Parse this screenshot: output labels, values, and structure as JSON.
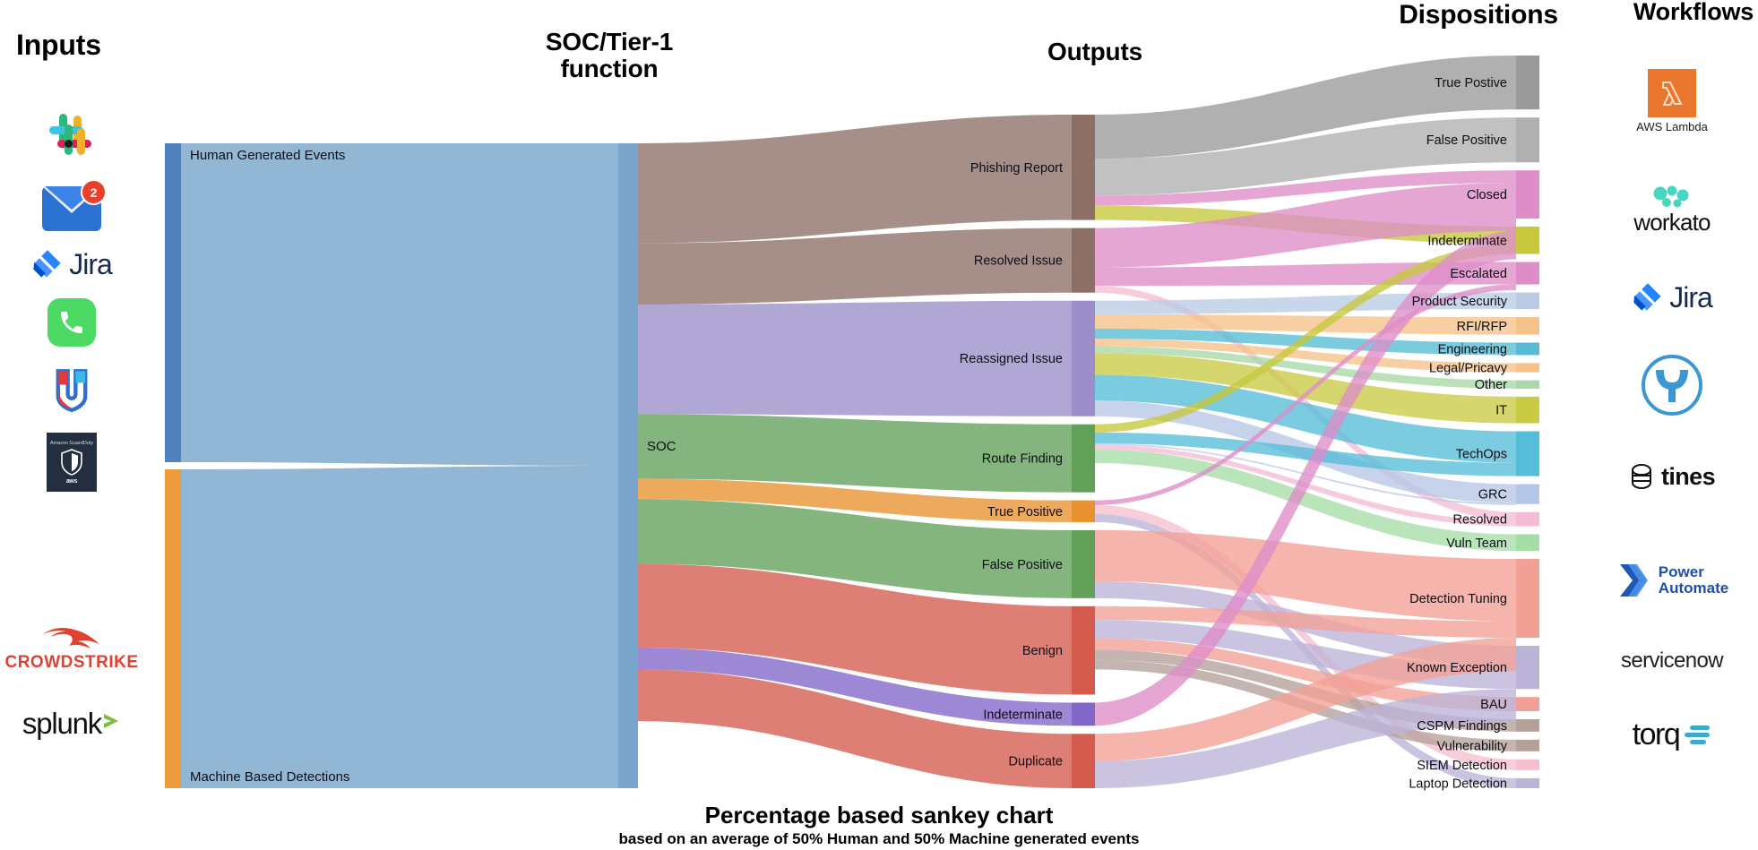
{
  "headers": {
    "inputs": "Inputs",
    "soc": "SOC/Tier-1\nfunction",
    "soc_line1": "SOC/Tier-1",
    "soc_line2": "function",
    "outputs": "Outputs",
    "dispositions": "Dispositions",
    "workflows": "Workflows"
  },
  "caption": {
    "title": "Percentage based sankey chart",
    "subtitle": "based on an average of 50% Human and 50% Machine generated events"
  },
  "input_logos": [
    {
      "name": "slack-logo",
      "label": ""
    },
    {
      "name": "email-logo",
      "label": "",
      "badge": "2"
    },
    {
      "name": "jira-logo",
      "label": "Jira"
    },
    {
      "name": "phone-logo",
      "label": ""
    },
    {
      "name": "jamf-logo",
      "label": ""
    },
    {
      "name": "amazon-guardduty-logo",
      "label": "Amazon GuardDuty",
      "sub": "aws"
    },
    {
      "name": "crowdstrike-logo",
      "label": "CROWDSTRIKE"
    },
    {
      "name": "splunk-logo",
      "label": "splunk"
    }
  ],
  "workflow_logos": [
    {
      "name": "aws-lambda-logo",
      "label": "AWS Lambda"
    },
    {
      "name": "workato-logo",
      "label": "workato"
    },
    {
      "name": "jira-logo",
      "label": "Jira"
    },
    {
      "name": "mulesoft-logo",
      "label": ""
    },
    {
      "name": "tines-logo",
      "label": "tines"
    },
    {
      "name": "power-automate-logo",
      "label": "Power Automate",
      "l1": "Power",
      "l2": "Automate"
    },
    {
      "name": "servicenow-logo",
      "label": "servicenow"
    },
    {
      "name": "torq-logo",
      "label": "torq"
    }
  ],
  "chart_data": {
    "type": "sankey",
    "title": "Percentage based sankey chart",
    "subtitle": "based on an average of 50% Human and 50% Machine generated events",
    "columns": [
      "Inputs",
      "SOC/Tier-1 function",
      "Outputs",
      "Dispositions"
    ],
    "units": "percent",
    "nodes": [
      {
        "id": "human",
        "label": "Human Generated Events",
        "column": 0,
        "value": 50,
        "color": "#4f81bd"
      },
      {
        "id": "machine",
        "label": "Machine Based Detections",
        "column": 0,
        "value": 50,
        "color": "#ed9c3c"
      },
      {
        "id": "soc",
        "label": "SOC",
        "column": 1,
        "value": 100,
        "color": "#7aa6cd"
      },
      {
        "id": "phishing",
        "label": "Phishing Report",
        "column": 2,
        "value": 15.5,
        "color": "#8c6f66"
      },
      {
        "id": "resolved_iss",
        "label": "Resolved Issue",
        "column": 2,
        "value": 9.5,
        "color": "#8c6f66"
      },
      {
        "id": "reassigned",
        "label": "Reassigned Issue",
        "column": 2,
        "value": 17.0,
        "color": "#9b8ec9"
      },
      {
        "id": "route",
        "label": "Route Finding",
        "column": 2,
        "value": 10.0,
        "color": "#62a05a"
      },
      {
        "id": "true_pos_o",
        "label": "True Positive",
        "column": 2,
        "value": 3.2,
        "color": "#e8922f"
      },
      {
        "id": "false_pos_o",
        "label": "False Positive",
        "column": 2,
        "value": 10.0,
        "color": "#62a05a"
      },
      {
        "id": "benign",
        "label": "Benign",
        "column": 2,
        "value": 13.0,
        "color": "#d45b4e"
      },
      {
        "id": "indet_o",
        "label": "Indeterminate",
        "column": 2,
        "value": 3.4,
        "color": "#8067c8"
      },
      {
        "id": "duplicate",
        "label": "Duplicate",
        "column": 2,
        "value": 8.0,
        "color": "#d45b4e"
      },
      {
        "id": "true_pos_d",
        "label": "True Postive",
        "column": 3,
        "value": 6.5,
        "color": "#9a9a9a"
      },
      {
        "id": "false_pos_d",
        "label": "False Positive",
        "column": 3,
        "value": 5.4,
        "color": "#b0b0b0"
      },
      {
        "id": "closed",
        "label": "Closed",
        "column": 3,
        "value": 5.8,
        "color": "#de8dc8"
      },
      {
        "id": "indet_d",
        "label": "Indeterminate",
        "column": 3,
        "value": 3.3,
        "color": "#c7c83c"
      },
      {
        "id": "escalated",
        "label": "Escalated",
        "column": 3,
        "value": 2.7,
        "color": "#de8dc8"
      },
      {
        "id": "prod_sec",
        "label": "Product Security",
        "column": 3,
        "value": 2.0,
        "color": "#bacce4"
      },
      {
        "id": "rfi_rfp",
        "label": "RFI/RFP",
        "column": 3,
        "value": 2.1,
        "color": "#f6c288"
      },
      {
        "id": "engineering",
        "label": "Engineering",
        "column": 3,
        "value": 1.5,
        "color": "#55bcd4"
      },
      {
        "id": "legal",
        "label": "Legal/Pricavy",
        "column": 3,
        "value": 1.1,
        "color": "#f6c288"
      },
      {
        "id": "other",
        "label": "Other",
        "column": 3,
        "value": 1.0,
        "color": "#a8d8a8"
      },
      {
        "id": "it",
        "label": "IT",
        "column": 3,
        "value": 3.2,
        "color": "#cacb45"
      },
      {
        "id": "techops",
        "label": "TechOps",
        "column": 3,
        "value": 5.4,
        "color": "#56bdd8"
      },
      {
        "id": "grc",
        "label": "GRC",
        "column": 3,
        "value": 2.4,
        "color": "#b6c6e6"
      },
      {
        "id": "resolved_d",
        "label": "Resolved",
        "column": 3,
        "value": 1.7,
        "color": "#f3bcd4"
      },
      {
        "id": "vuln_team",
        "label": "Vuln Team",
        "column": 3,
        "value": 2.0,
        "color": "#a6dda6"
      },
      {
        "id": "det_tuning",
        "label": "Detection Tuning",
        "column": 3,
        "value": 9.5,
        "color": "#f2a096"
      },
      {
        "id": "known_exc",
        "label": "Known Exception",
        "column": 3,
        "value": 5.2,
        "color": "#bcb4d8"
      },
      {
        "id": "bau",
        "label": "BAU",
        "column": 3,
        "value": 1.7,
        "color": "#f2a096"
      },
      {
        "id": "cspm",
        "label": "CSPM Findings",
        "column": 3,
        "value": 1.5,
        "color": "#b5a09a"
      },
      {
        "id": "vulnerability",
        "label": "Vulnerability",
        "column": 3,
        "value": 1.4,
        "color": "#b5a09a"
      },
      {
        "id": "siem_det",
        "label": "SIEM Detection",
        "column": 3,
        "value": 1.3,
        "color": "#f6bfce"
      },
      {
        "id": "laptop_det",
        "label": "Laptop Detection",
        "column": 3,
        "value": 1.2,
        "color": "#bcb4d8"
      }
    ],
    "links": [
      {
        "source": "human",
        "target": "soc",
        "value": 50
      },
      {
        "source": "machine",
        "target": "soc",
        "value": 50
      },
      {
        "source": "soc",
        "target": "phishing",
        "value": 15.5
      },
      {
        "source": "soc",
        "target": "resolved_iss",
        "value": 9.5
      },
      {
        "source": "soc",
        "target": "reassigned",
        "value": 17.0
      },
      {
        "source": "soc",
        "target": "route",
        "value": 10.0
      },
      {
        "source": "soc",
        "target": "true_pos_o",
        "value": 3.2
      },
      {
        "source": "soc",
        "target": "false_pos_o",
        "value": 10.0
      },
      {
        "source": "soc",
        "target": "benign",
        "value": 13.0
      },
      {
        "source": "soc",
        "target": "indet_o",
        "value": 3.4
      },
      {
        "source": "soc",
        "target": "duplicate",
        "value": 8.0
      },
      {
        "source": "phishing",
        "target": "true_pos_d",
        "value": 6.5
      },
      {
        "source": "phishing",
        "target": "false_pos_d",
        "value": 5.4
      },
      {
        "source": "phishing",
        "target": "indet_d",
        "value": 2.1
      },
      {
        "source": "phishing",
        "target": "closed",
        "value": 1.5
      },
      {
        "source": "resolved_iss",
        "target": "closed",
        "value": 5.8
      },
      {
        "source": "resolved_iss",
        "target": "escalated",
        "value": 2.7
      },
      {
        "source": "resolved_iss",
        "target": "resolved_d",
        "value": 1.0
      },
      {
        "source": "reassigned",
        "target": "prod_sec",
        "value": 2.0
      },
      {
        "source": "reassigned",
        "target": "rfi_rfp",
        "value": 2.1
      },
      {
        "source": "reassigned",
        "target": "engineering",
        "value": 1.5
      },
      {
        "source": "reassigned",
        "target": "legal",
        "value": 1.1
      },
      {
        "source": "reassigned",
        "target": "other",
        "value": 1.0
      },
      {
        "source": "reassigned",
        "target": "it",
        "value": 3.2
      },
      {
        "source": "reassigned",
        "target": "techops",
        "value": 3.8
      },
      {
        "source": "reassigned",
        "target": "grc",
        "value": 2.3
      },
      {
        "source": "route",
        "target": "techops",
        "value": 1.6
      },
      {
        "source": "route",
        "target": "vuln_team",
        "value": 2.0
      },
      {
        "source": "route",
        "target": "indet_d",
        "value": 1.2
      },
      {
        "source": "route",
        "target": "resolved_d",
        "value": 0.7
      },
      {
        "source": "route",
        "target": "grc",
        "value": 0.2
      },
      {
        "source": "true_pos_o",
        "target": "siem_det",
        "value": 1.3
      },
      {
        "source": "true_pos_o",
        "target": "laptop_det",
        "value": 1.2
      },
      {
        "source": "true_pos_o",
        "target": "escalated",
        "value": 0.7
      },
      {
        "source": "false_pos_o",
        "target": "det_tuning",
        "value": 7.5
      },
      {
        "source": "false_pos_o",
        "target": "known_exc",
        "value": 2.5
      },
      {
        "source": "benign",
        "target": "known_exc",
        "value": 2.7
      },
      {
        "source": "benign",
        "target": "bau",
        "value": 1.7
      },
      {
        "source": "benign",
        "target": "det_tuning",
        "value": 2.0
      },
      {
        "source": "benign",
        "target": "cspm",
        "value": 1.5
      },
      {
        "source": "benign",
        "target": "vulnerability",
        "value": 1.4
      },
      {
        "source": "indet_o",
        "target": "closed",
        "value": 3.4
      },
      {
        "source": "duplicate",
        "target": "det_tuning",
        "value": 4.0
      },
      {
        "source": "duplicate",
        "target": "known_exc",
        "value": 4.0
      }
    ]
  }
}
